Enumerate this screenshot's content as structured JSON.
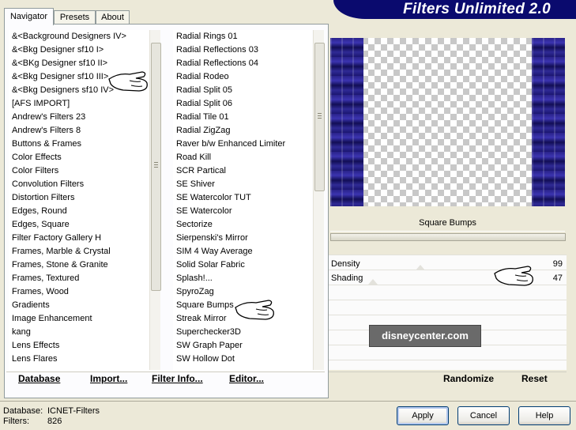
{
  "tabs": [
    {
      "label": "Navigator"
    },
    {
      "label": "Presets"
    },
    {
      "label": "About"
    }
  ],
  "banner": {
    "title": "Filters Unlimited 2.0"
  },
  "categories": [
    "&<Background Designers IV>",
    "&<Bkg Designer sf10 I>",
    "&<BKg Designer sf10 II>",
    "&<Bkg Designer sf10 III>",
    "&<Bkg Designers sf10 IV>",
    "[AFS IMPORT]",
    "Andrew's Filters 23",
    "Andrew's Filters 8",
    "Buttons & Frames",
    "Color Effects",
    "Color Filters",
    "Convolution Filters",
    "Distortion Filters",
    "Edges, Round",
    "Edges, Square",
    "Filter Factory Gallery H",
    "Frames, Marble & Crystal",
    "Frames, Stone & Granite",
    "Frames, Textured",
    "Frames, Wood",
    "Gradients",
    "Image Enhancement",
    "kang",
    "Lens Effects",
    "Lens Flares"
  ],
  "filters": [
    "Radial  Rings 01",
    "Radial Reflections 03",
    "Radial Reflections 04",
    "Radial Rodeo",
    "Radial Split 05",
    "Radial Split 06",
    "Radial Tile 01",
    "Radial ZigZag",
    "Raver b/w Enhanced Limiter",
    "Road Kill",
    "SCR  Partical",
    "SE Shiver",
    "SE Watercolor TUT",
    "SE Watercolor",
    "Sectorize",
    "Sierpenski's Mirror",
    "SIM 4 Way Average",
    "Solid Solar Fabric",
    "Splash!...",
    "SpyroZag",
    "Square Bumps",
    "Streak Mirror",
    "Superchecker3D",
    "SW Graph Paper",
    "SW Hollow Dot"
  ],
  "panel_buttons": {
    "database": "Database",
    "import": "Import...",
    "filter_info": "Filter Info...",
    "editor": "Editor..."
  },
  "selected_filter_name": "Square Bumps",
  "parameters": [
    {
      "name": "Density",
      "value": "99"
    },
    {
      "name": "Shading",
      "value": "47"
    }
  ],
  "right_buttons": {
    "randomize": "Randomize",
    "reset": "Reset"
  },
  "watermark": "disneycenter.com",
  "footer": {
    "database_label": "Database:",
    "database_value": "ICNET-Filters",
    "filters_label": "Filters:",
    "filters_value": "826"
  },
  "dialog_buttons": {
    "apply": "Apply",
    "cancel": "Cancel",
    "help": "Help"
  },
  "colors": {
    "banner": "#0a0a6e",
    "bumps": "#2a238a"
  },
  "icons": {
    "pointer": "white-glove-pointer-icon"
  }
}
